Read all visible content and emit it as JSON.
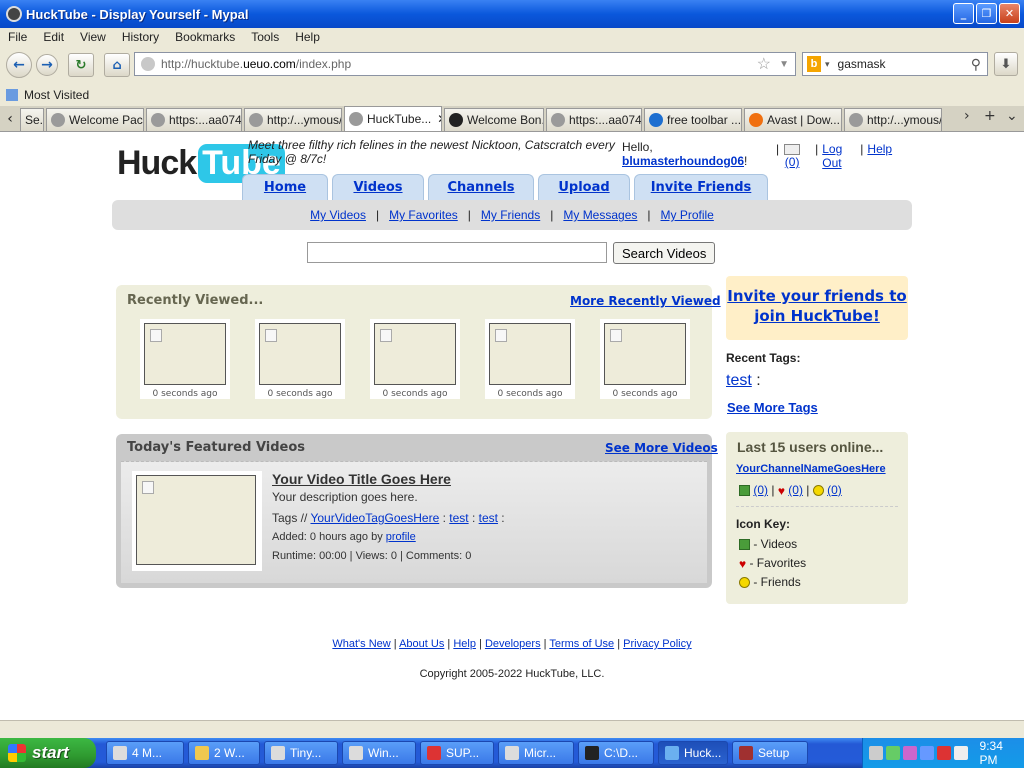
{
  "window": {
    "title": "HuckTube - Display Yourself - Mypal"
  },
  "menu": [
    "File",
    "Edit",
    "View",
    "History",
    "Bookmarks",
    "Tools",
    "Help"
  ],
  "nav": {
    "url_prefix": "http://hucktube.",
    "url_domain": "ueuo.com",
    "url_suffix": "/index.php",
    "search_value": "gasmask"
  },
  "bookmarks": {
    "most_visited": "Most Visited"
  },
  "tabs": [
    "Se...",
    "Welcome Pac...",
    "https:...aa074f",
    "http:/...ymous/",
    "HuckTube...",
    "Welcome Bon...",
    "https:...aa074f",
    "free toolbar ...",
    "Avast | Dow...",
    "http:/...ymous/"
  ],
  "site": {
    "logo_left": "Huck",
    "logo_right": "Tube",
    "promo": "Meet three filthy rich felines in the newest Nicktoon, Catscratch every Friday @ 8/7c!",
    "hello": "Hello,",
    "username": "blumasterhoundog06",
    "msg_count": "(0)",
    "logout1": "Log",
    "logout2": "Out",
    "help": "Help",
    "main_tabs": [
      "Home",
      "Videos",
      "Channels",
      "Upload",
      "Invite Friends"
    ],
    "sub_nav": [
      "My Videos",
      "My Favorites",
      "My Friends",
      "My Messages",
      "My Profile"
    ],
    "search_button": "Search Videos",
    "recent": {
      "title": "Recently Viewed...",
      "more": "More Recently Viewed",
      "items": [
        "0 seconds ago",
        "0 seconds ago",
        "0 seconds ago",
        "0 seconds ago",
        "0 seconds ago"
      ]
    },
    "featured": {
      "title": "Today's Featured Videos",
      "more": "See More Videos",
      "video_title": "Your Video Title Goes Here",
      "description": "Your description goes here.",
      "tags_label": "Tags //",
      "tags": [
        "YourVideoTagGoesHere",
        "test",
        "test"
      ],
      "added_prefix": "Added: 0 hours ago by",
      "added_by": "profile",
      "stats": "Runtime: 00:00 | Views: 0 | Comments: 0"
    },
    "invite": {
      "line1": "Invite your friends to",
      "line2": "join HuckTube!"
    },
    "recent_tags": {
      "label": "Recent Tags:",
      "tag": "test",
      "more": "See More Tags"
    },
    "online": {
      "title": "Last 15 users online...",
      "user": "YourChannelNameGoesHere",
      "counts": [
        "(0)",
        "(0)",
        "(0)"
      ],
      "icon_key": "Icon Key:",
      "keys": [
        "- Videos",
        "- Favorites",
        "- Friends"
      ]
    },
    "footer_links": [
      "What's New",
      "About Us",
      "Help",
      "Developers",
      "Terms of Use",
      "Privacy Policy"
    ],
    "copyright": "Copyright 2005-2022 HuckTube, LLC."
  },
  "taskbar": {
    "start": "start",
    "tasks": [
      "4 M...",
      "2 W...",
      "Tiny...",
      "Win...",
      "SUP...",
      "Micr...",
      "C:\\D...",
      "Huck...",
      "Setup"
    ],
    "time": "9:34 PM"
  }
}
